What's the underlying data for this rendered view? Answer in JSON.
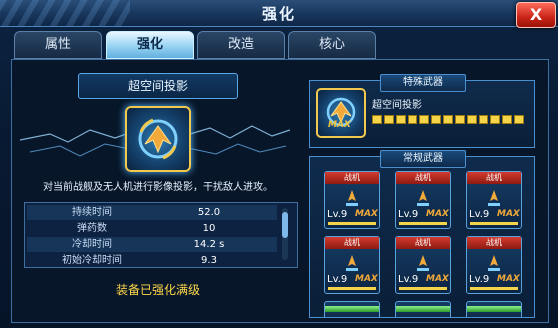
{
  "window": {
    "title": "强化",
    "close_label": "X"
  },
  "tabs": [
    {
      "label": "属性",
      "active": false
    },
    {
      "label": "强化",
      "active": true
    },
    {
      "label": "改造",
      "active": false
    },
    {
      "label": "核心",
      "active": false
    }
  ],
  "skill": {
    "name": "超空间投影",
    "description": "对当前战舰及无人机进行影像投影，干扰敌人进攻。",
    "icon": "hyperspace-projection-icon",
    "stats": [
      {
        "label": "持续时间",
        "value": "52.0"
      },
      {
        "label": "弹药数",
        "value": "10"
      },
      {
        "label": "冷却时间",
        "value": "14.2 s"
      },
      {
        "label": "初始冷却时间",
        "value": "9.3"
      }
    ],
    "status": "装备已强化满级"
  },
  "special_weapon": {
    "section_title": "特殊武器",
    "name": "超空间投影",
    "max_label": "MAX",
    "level_segments_filled": 13,
    "level_segments_total": 13
  },
  "normal_weapons": {
    "section_title": "常规武器",
    "cards": [
      {
        "type": "战机",
        "level": "Lv.9",
        "max": "MAX"
      },
      {
        "type": "战机",
        "level": "Lv.9",
        "max": "MAX"
      },
      {
        "type": "战机",
        "level": "Lv.9",
        "max": "MAX"
      },
      {
        "type": "战机",
        "level": "Lv.9",
        "max": "MAX"
      },
      {
        "type": "战机",
        "level": "Lv.9",
        "max": "MAX"
      },
      {
        "type": "战机",
        "level": "Lv.9",
        "max": "MAX"
      }
    ]
  },
  "colors": {
    "accent": "#f5d44a",
    "tab_active": "#9fd6f4",
    "card_header": "#d33a2c",
    "max_text": "#f0a83a"
  }
}
